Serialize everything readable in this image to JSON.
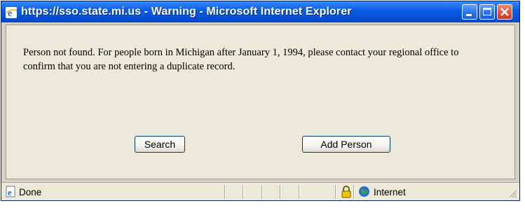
{
  "window": {
    "title": "https://sso.state.mi.us - Warning - Microsoft Internet Explorer",
    "controls": [
      "minimize",
      "maximize",
      "close"
    ]
  },
  "message": "Person not found. For people born in Michigan after January 1, 1994, please contact your regional office to confirm that you are not entering a duplicate record.",
  "buttons": {
    "search": "Search",
    "add_person": "Add Person"
  },
  "statusbar": {
    "status": "Done",
    "zone": "Internet",
    "icons": [
      "ie-page-icon",
      "lock-icon",
      "globe-icon"
    ]
  },
  "colors": {
    "titlebar": "#0b5ee8",
    "dialog_background": "#ece9d8",
    "close_button": "#e0503a"
  }
}
